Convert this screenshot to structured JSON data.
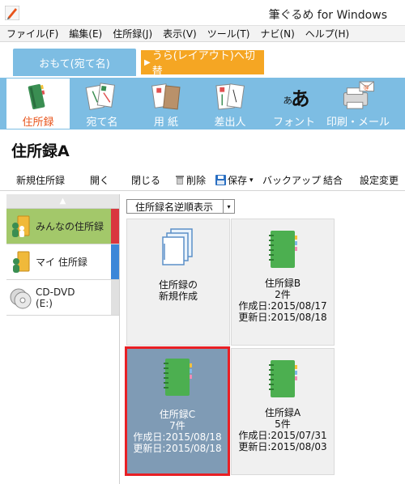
{
  "window": {
    "title": "筆ぐるめ for Windows"
  },
  "menu": [
    "ファイル(F)",
    "編集(E)",
    "住所録(J)",
    "表示(V)",
    "ツール(T)",
    "ナビ(N)",
    "ヘルプ(H)"
  ],
  "tabs": {
    "front": "おもて(宛て名)",
    "back": "うら(レイアウト)へ切替",
    "back_arrow": "▶"
  },
  "ribbon": [
    "住所録",
    "宛て名",
    "用 紙",
    "差出人",
    "フォント",
    "印刷・メール"
  ],
  "page_title": "住所録A",
  "toolbar": [
    "新規住所録",
    "開く",
    "閉じる",
    "削除",
    "保存",
    "バックアップ",
    "結合",
    "設定変更"
  ],
  "sidebar": {
    "scroll_up": "▲",
    "items": [
      {
        "label": "みんなの住所録",
        "strip": "#d9363e"
      },
      {
        "label": "マイ 住所録",
        "strip": "#3b86d8"
      },
      {
        "label": "CD-DVD",
        "sublabel": "(E:)"
      }
    ]
  },
  "sort_select": "住所録名逆順表示",
  "cards": [
    {
      "line1": "住所録の",
      "line2": "新規作成"
    },
    {
      "name": "住所録B",
      "count": "2件",
      "created": "作成日:2015/08/17",
      "updated": "更新日:2015/08/18"
    },
    {
      "name": "住所録C",
      "count": "7件",
      "created": "作成日:2015/08/18",
      "updated": "更新日:2015/08/18"
    },
    {
      "name": "住所録A",
      "count": "5件",
      "created": "作成日:2015/07/31",
      "updated": "更新日:2015/08/03"
    }
  ],
  "colors": {
    "accent_blue": "#7dbde3",
    "accent_orange": "#f5a623",
    "active_red": "#e8541b",
    "selection_border": "#e81f24",
    "selected_card": "#7f9bb5",
    "selected_sidebar": "#a3c86a"
  }
}
